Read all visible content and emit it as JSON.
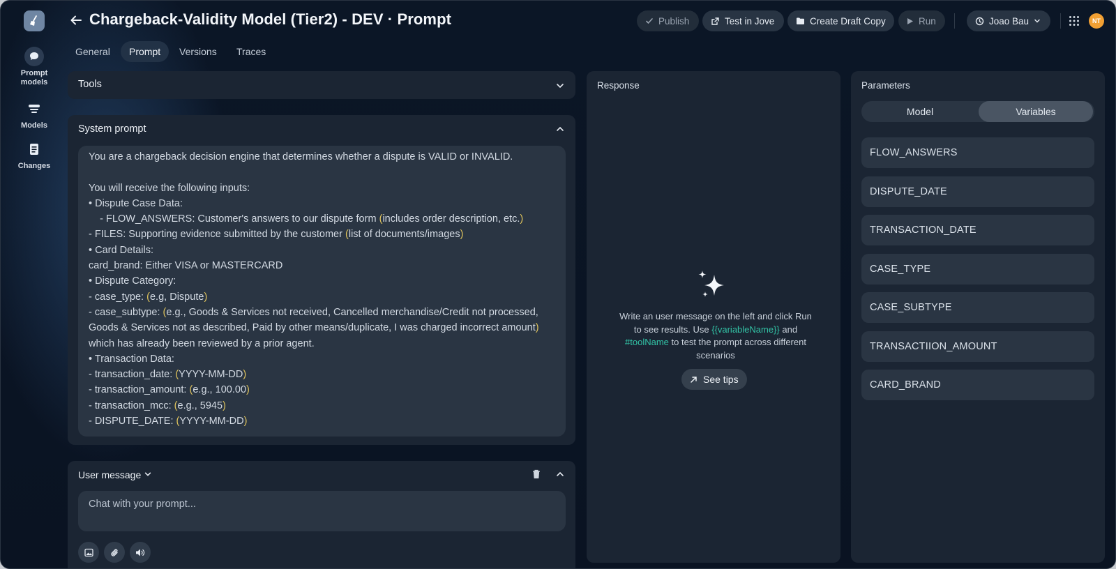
{
  "header": {
    "title": "Chargeback-Validity Model (Tier2) - DEV · Prompt",
    "publish_label": "Publish",
    "test_label": "Test in Jove",
    "draft_label": "Create Draft Copy",
    "run_label": "Run",
    "user_label": "Joao Bau",
    "avatar_initials": "NT"
  },
  "sidebar": {
    "items": [
      {
        "label": "Prompt models",
        "icon": "chat-bubble-icon"
      },
      {
        "label": "Models",
        "icon": "layers-icon"
      },
      {
        "label": "Changes",
        "icon": "document-icon"
      }
    ]
  },
  "tabs": [
    "General",
    "Prompt",
    "Versions",
    "Traces"
  ],
  "active_tab": "Prompt",
  "tools": {
    "title": "Tools"
  },
  "system_prompt": {
    "title": "System prompt",
    "intro": "You are a chargeback decision engine that determines whether a dispute is VALID or INVALID.",
    "inputs_heading": "You will receive the following inputs:",
    "dispute_case": "• Dispute Case Data:",
    "flow_answers": "    - FLOW_ANSWERS: Customer's answers to our dispute form (includes order description, etc.)",
    "files": "- FILES: Supporting evidence submitted by the customer (list of documents/images)",
    "card_details": "• Card Details:",
    "card_brand": "card_brand: Either VISA or MASTERCARD",
    "dispute_category": "• Dispute Category:",
    "case_type": "- case_type: (e.g, Dispute)",
    "case_subtype": "- case_subtype: (e.g., Goods & Services not received, Cancelled merchandise/Credit not processed, Goods & Services not as described, Paid by other means/duplicate, I was charged incorrect amount) which has already been reviewed by a prior agent.",
    "transaction_data": "• Transaction Data:",
    "transaction_date": "- transaction_date: (YYYY-MM-DD)",
    "transaction_amount": "- transaction_amount: (e.g., 100.00)",
    "transaction_mcc": "- transaction_mcc: (e.g., 5945)",
    "dispute_date": "- DISPUTE_DATE: (YYYY-MM-DD)"
  },
  "user_message": {
    "title": "User message",
    "placeholder": "Chat with your prompt..."
  },
  "response": {
    "title": "Response",
    "msg_part1": "Write an user message on the left and click Run to see results. Use ",
    "msg_var": "{{variableName}}",
    "msg_part2": " and ",
    "msg_tool": "#toolName",
    "msg_part3": " to test the prompt across different scenarios",
    "tips_label": "See tips"
  },
  "parameters": {
    "title": "Parameters",
    "segments": [
      "Model",
      "Variables"
    ],
    "active_segment": "Variables",
    "variables": [
      "FLOW_ANSWERS",
      "DISPUTE_DATE",
      "TRANSACTION_DATE",
      "CASE_TYPE",
      "CASE_SUBTYPE",
      "TRANSACTIION_AMOUNT",
      "CARD_BRAND"
    ]
  },
  "colors": {
    "accent_teal": "#32c3a6",
    "paren_yellow": "#e0c45c",
    "avatar_orange": "#f2a033"
  }
}
